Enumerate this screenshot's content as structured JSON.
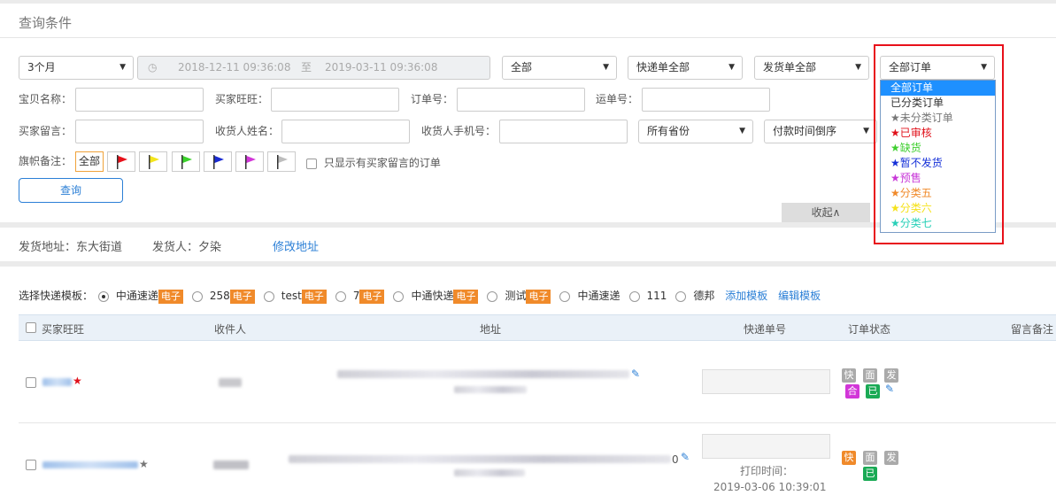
{
  "query": {
    "title": "查询条件",
    "period": "3个月",
    "date_start": "2018-12-11 09:36:08",
    "date_sep": "至",
    "date_end": "2019-03-11 09:36:08",
    "filter_all": "全部",
    "express_filter": "快递单全部",
    "ship_filter": "发货单全部",
    "order_filter": "全部订单",
    "labels": {
      "item_name": "宝贝名称：",
      "buyer_ww": "买家旺旺：",
      "order_no": "订单号：",
      "waybill_no": "运单号：",
      "buyer_msg": "买家留言：",
      "receiver_name": "收货人姓名：",
      "receiver_phone": "收货人手机号：",
      "flag_remark": "旗帜备注："
    },
    "province": "所有省份",
    "sort": "付款时间倒序",
    "flag_all": "全部",
    "only_msg": "只显示有买家留言的订单",
    "search_btn": "查询",
    "collapse": "收起∧"
  },
  "order_dropdown": {
    "items": [
      {
        "text": "全部订单",
        "color": "#ffffff",
        "selected": true
      },
      {
        "text": "已分类订单",
        "color": "#333333"
      },
      {
        "text": "★未分类订单",
        "color": "#777777"
      },
      {
        "text": "★已审核",
        "color": "#e0101a"
      },
      {
        "text": "★缺货",
        "color": "#3fcf2f"
      },
      {
        "text": "★暂不发货",
        "color": "#1530d8"
      },
      {
        "text": "★预售",
        "color": "#c837d8"
      },
      {
        "text": "★分类五",
        "color": "#f08a2a"
      },
      {
        "text": "★分类六",
        "color": "#f5e21a"
      },
      {
        "text": "★分类七",
        "color": "#29d0b8"
      }
    ]
  },
  "flags": [
    "#e8101a",
    "#f3e51c",
    "#3bd22b",
    "#1a2bd3",
    "#d236d8",
    "#bdbdbd"
  ],
  "address": {
    "ship_addr": "发货地址：东大街道",
    "sender": "发货人：夕染",
    "modify": "修改地址"
  },
  "templates": {
    "label": "选择快递模板：",
    "items": [
      {
        "name": "中通速递",
        "tag": "电子",
        "checked": true
      },
      {
        "name": "258",
        "tag": "电子"
      },
      {
        "name": "test",
        "tag": "电子"
      },
      {
        "name": "7",
        "tag": "电子"
      },
      {
        "name": "中通快递",
        "tag": "电子"
      },
      {
        "name": "测试",
        "tag": "电子"
      },
      {
        "name": "中通速递",
        "tag": ""
      },
      {
        "name": "111",
        "tag": ""
      },
      {
        "name": "德邦",
        "tag": ""
      }
    ],
    "add": "添加模板",
    "edit": "编辑模板"
  },
  "table": {
    "headers": [
      "买家旺旺",
      "收件人",
      "地址",
      "快递单号",
      "订单状态",
      "留言备注"
    ],
    "row2_tail": "0",
    "print_label": "打印时间：",
    "print_time": "2019-03-06 10:39:01",
    "badges": {
      "kuai": "快",
      "mian": "面",
      "fa": "发",
      "he": "合",
      "yi": "已"
    }
  }
}
